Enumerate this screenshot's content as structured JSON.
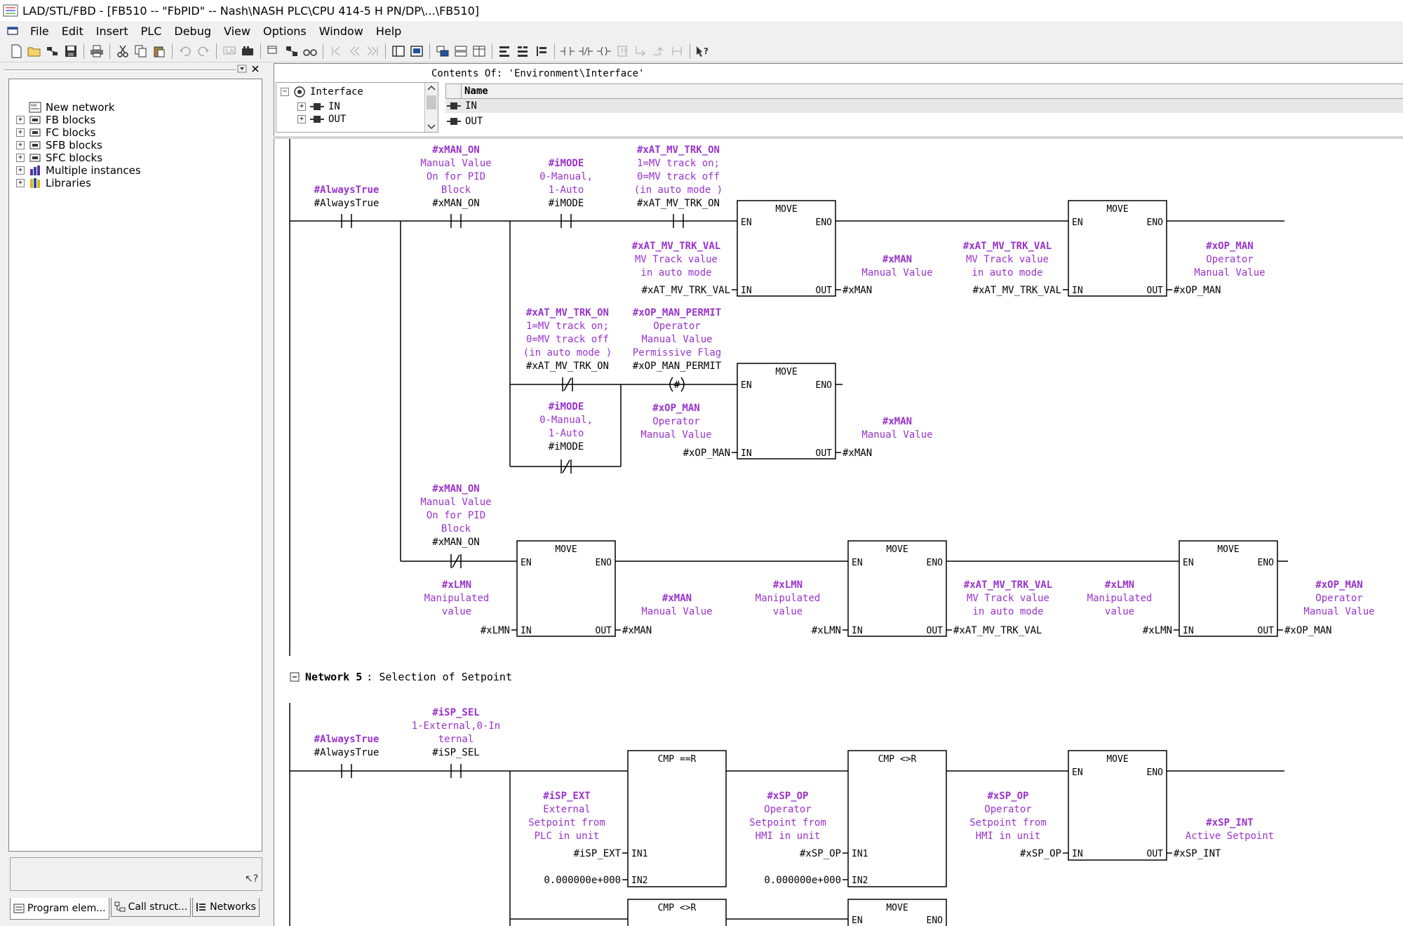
{
  "window": {
    "title": "LAD/STL/FBD  - [FB510 -- \"FbPID\" -- Nash\\NASH PLC\\CPU 414-5 H PN/DP\\...\\FB510]"
  },
  "menu": [
    "File",
    "Edit",
    "Insert",
    "PLC",
    "Debug",
    "View",
    "Options",
    "Window",
    "Help"
  ],
  "toolbar_icons": [
    "new-icon",
    "open-icon",
    "accessible-nodes-icon",
    "save-icon",
    "print-icon",
    "cut-icon",
    "copy-icon",
    "paste-icon",
    "undo-icon",
    "redo-icon",
    "monitor-icon",
    "module-info-icon",
    "download-icon",
    "view-icon",
    "glasses-icon",
    "first-icon",
    "prev-icon",
    "next-icon",
    "overview-icon",
    "detail-icon",
    "ref-icon",
    "tile-icon",
    "split-icon",
    "new-network-icon",
    "insert-network-icon",
    "network-icon",
    "contact-no-icon",
    "contact-nc-icon",
    "branch-icon",
    "open-branch-icon",
    "close-branch-icon",
    "coil-icon",
    "box-icon",
    "jump-icon",
    "connection-icon",
    "help-icon"
  ],
  "sidebar": {
    "items": [
      {
        "label": "New network",
        "expandable": false
      },
      {
        "label": "FB blocks",
        "expandable": true
      },
      {
        "label": "FC blocks",
        "expandable": true
      },
      {
        "label": "SFB blocks",
        "expandable": true
      },
      {
        "label": "SFC blocks",
        "expandable": true
      },
      {
        "label": "Multiple instances",
        "expandable": true
      },
      {
        "label": "Libraries",
        "expandable": true
      }
    ],
    "tabs": [
      "Program elem...",
      "Call struct...",
      "Networks"
    ]
  },
  "interface": {
    "contents_label": "Contents Of: 'Environment\\Interface'",
    "tree": [
      "Interface",
      "IN",
      "OUT"
    ],
    "column_header": "Name",
    "rows": [
      "IN",
      "OUT"
    ]
  },
  "network5": {
    "prefix": "Network 5",
    "title": ": Selection of Setpoint"
  },
  "ladder": {
    "n4": {
      "c_always": {
        "sym": "#AlwaysTrue",
        "cmt": [],
        "addr": "#AlwaysTrue"
      },
      "c_manon": {
        "sym": "#xMAN_ON",
        "cmt": [
          "Manual Value",
          "On for PID",
          "Block"
        ],
        "addr": "#xMAN_ON"
      },
      "c_imode": {
        "sym": "#iMODE",
        "cmt": [
          "0-Manual,",
          "1-Auto"
        ],
        "addr": "#iMODE"
      },
      "c_trkon": {
        "sym": "#xAT_MV_TRK_ON",
        "cmt": [
          "1=MV track on;",
          "0=MV track off",
          "(in auto mode )"
        ],
        "addr": "#xAT_MV_TRK_ON"
      },
      "b1": {
        "title": "MOVE",
        "in_sym": "#xAT_MV_TRK_VAL",
        "in_cmt": [
          "MV Track value",
          "in auto mode"
        ],
        "in_addr": "#xAT_MV_TRK_VAL",
        "out_sym": "#xMAN",
        "out_cmt": [
          "Manual Value"
        ],
        "out_addr": "#xMAN"
      },
      "b2": {
        "title": "MOVE",
        "in_sym": "#xAT_MV_TRK_VAL",
        "in_cmt": [
          "MV Track value",
          "in auto mode"
        ],
        "in_addr": "#xAT_MV_TRK_VAL",
        "out_sym": "#xOP_MAN",
        "out_cmt": [
          "Operator",
          "Manual Value"
        ],
        "out_addr": "#xOP_MAN"
      },
      "c_trkon2": {
        "sym": "#xAT_MV_TRK_ON",
        "cmt": [
          "1=MV track on;",
          "0=MV track off",
          "(in auto mode )"
        ],
        "addr": "#xAT_MV_TRK_ON"
      },
      "c_permit": {
        "sym": "#xOP_MAN_PERMIT",
        "cmt": [
          "Operator",
          "Manual Value",
          "Permissive Flag"
        ],
        "addr": "#xOP_MAN_PERMIT"
      },
      "coil_mid": "#",
      "c_imode2": {
        "sym": "#iMODE",
        "cmt": [
          "0-Manual,",
          "1-Auto"
        ],
        "addr": "#iMODE"
      },
      "b3": {
        "title": "MOVE",
        "in_sym": "#xOP_MAN",
        "in_cmt": [
          "Operator",
          "Manual Value"
        ],
        "in_addr": "#xOP_MAN",
        "out_sym": "#xMAN",
        "out_cmt": [
          "Manual Value"
        ],
        "out_addr": "#xMAN"
      },
      "c_manon2": {
        "sym": "#xMAN_ON",
        "cmt": [
          "Manual Value",
          "On for PID",
          "Block"
        ],
        "addr": "#xMAN_ON"
      },
      "b4": {
        "title": "MOVE",
        "in_sym": "#xLMN",
        "in_cmt": [
          "Manipulated",
          "value"
        ],
        "in_addr": "#xLMN",
        "out_sym": "#xMAN",
        "out_cmt": [
          "Manual Value"
        ],
        "out_addr": "#xMAN"
      },
      "b5": {
        "title": "MOVE",
        "in_sym": "#xLMN",
        "in_cmt": [
          "Manipulated",
          "value"
        ],
        "in_addr": "#xLMN",
        "out_sym": "#xAT_MV_TRK_VAL",
        "out_cmt": [
          "MV Track value",
          "in auto mode"
        ],
        "out_addr": "#xAT_MV_TRK_VAL"
      },
      "b6": {
        "title": "MOVE",
        "in_sym": "#xLMN",
        "in_cmt": [
          "Manipulated",
          "value"
        ],
        "in_addr": "#xLMN",
        "out_sym": "#xOP_MAN",
        "out_cmt": [
          "Operator",
          "Manual Value"
        ],
        "out_addr": "#xOP_MAN"
      }
    },
    "n5": {
      "c_always": {
        "sym": "#AlwaysTrue",
        "cmt": [],
        "addr": "#AlwaysTrue"
      },
      "c_spsel": {
        "sym": "#iSP_SEL",
        "cmt": [
          "1-External,0-In",
          "ternal"
        ],
        "addr": "#iSP_SEL"
      },
      "cmp1": {
        "title": "CMP ==R",
        "in1_sym": "#iSP_EXT",
        "in1_cmt": [
          "External",
          "Setpoint from",
          "PLC in unit"
        ],
        "in1_addr": "#iSP_EXT",
        "in2_addr": "0.000000e+000"
      },
      "cmp2": {
        "title": "CMP <>R",
        "in1_sym": "#xSP_OP",
        "in1_cmt": [
          "Operator",
          "Setpoint from",
          "HMI in unit"
        ],
        "in1_addr": "#xSP_OP",
        "in2_addr": "0.000000e+000"
      },
      "b7": {
        "title": "MOVE",
        "in_sym": "#xSP_OP",
        "in_cmt": [
          "Operator",
          "Setpoint from",
          "HMI in unit"
        ],
        "in_addr": "#xSP_OP",
        "out_sym": "#xSP_INT",
        "out_cmt": [
          "Active Setpoint"
        ],
        "out_addr": "#xSP_INT"
      },
      "cmp3": {
        "title": "CMP <>R"
      },
      "b8": {
        "title": "MOVE"
      }
    },
    "pins": {
      "en": "EN",
      "eno": "ENO",
      "in": "IN",
      "out": "OUT",
      "in1": "IN1",
      "in2": "IN2"
    }
  },
  "colors": {
    "symbol": "#9933cc",
    "line": "#000000",
    "window_bg": "#f0f0f0"
  }
}
